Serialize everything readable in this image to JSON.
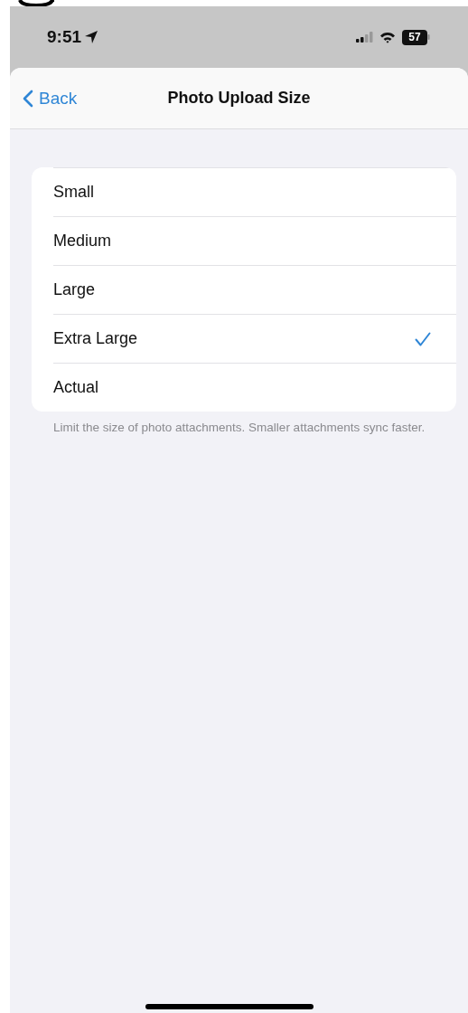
{
  "status_bar": {
    "time": "9:51",
    "battery": "57"
  },
  "nav": {
    "back": "Back",
    "title": "Photo Upload Size"
  },
  "options": [
    {
      "label": "Small",
      "selected": false
    },
    {
      "label": "Medium",
      "selected": false
    },
    {
      "label": "Large",
      "selected": false
    },
    {
      "label": "Extra Large",
      "selected": true
    },
    {
      "label": "Actual",
      "selected": false
    }
  ],
  "footer": "Limit the size of photo attachments. Smaller attachments sync faster."
}
